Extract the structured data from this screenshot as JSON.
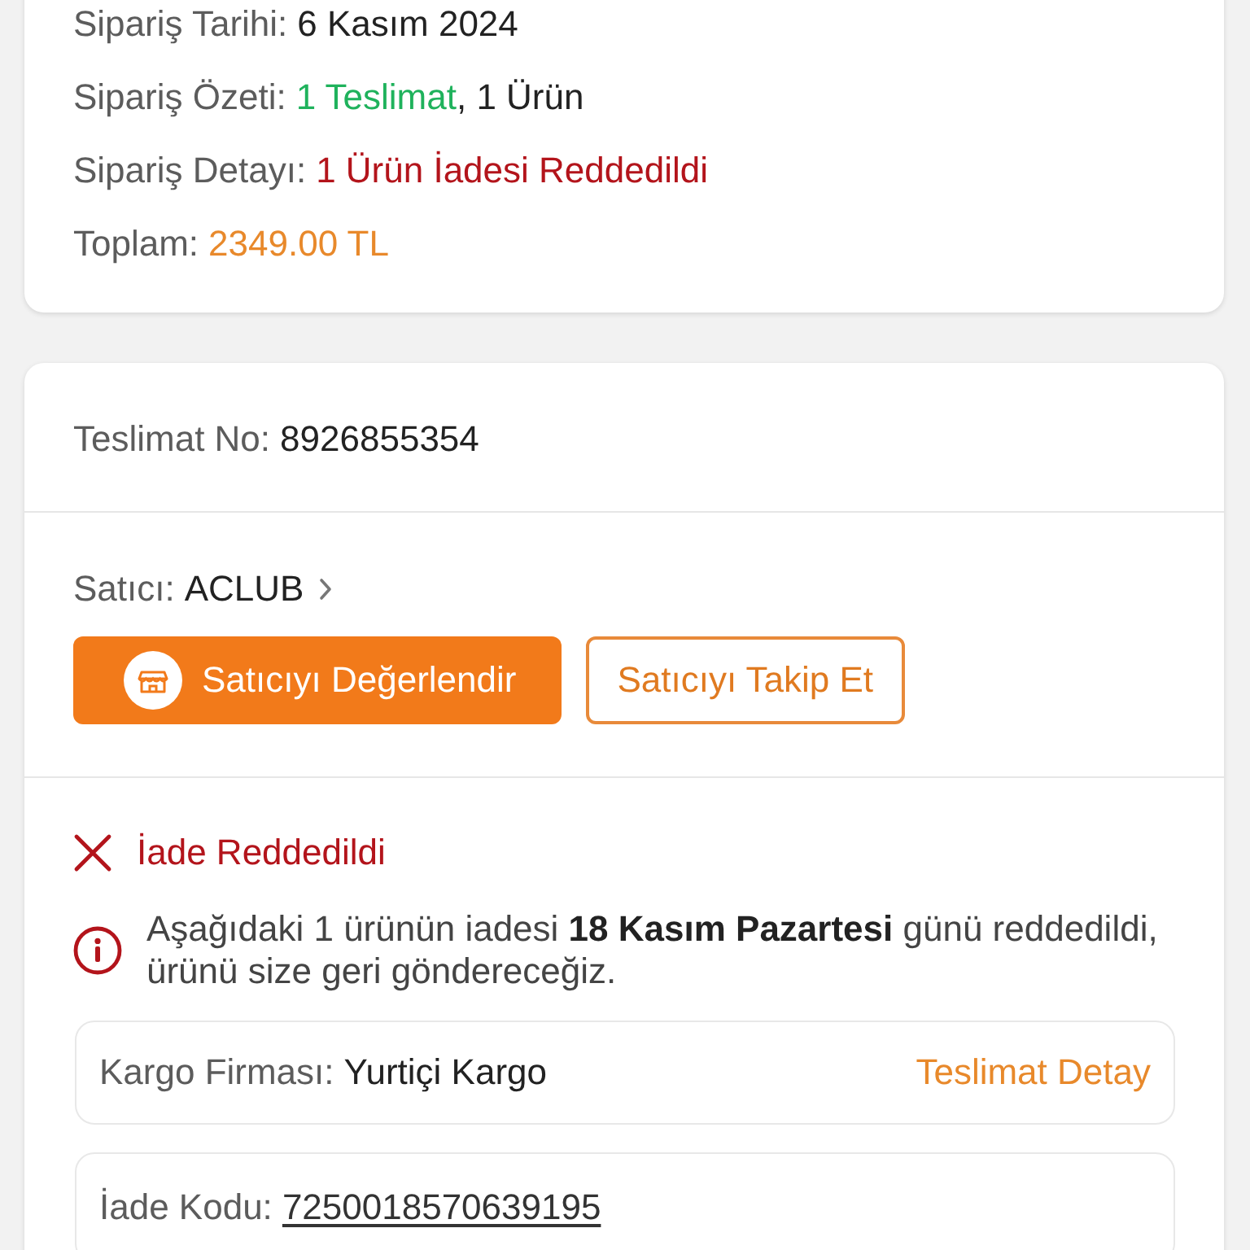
{
  "order_summary": {
    "rows": [
      {
        "label": "Sipariş Tarihi:",
        "value": [
          {
            "text": "6 Kasım 2024",
            "kind": "plain"
          }
        ]
      },
      {
        "label": "Sipariş Özeti:",
        "value": [
          {
            "text": "1 Teslimat",
            "kind": "success"
          },
          {
            "text": ", 1 Ürün",
            "kind": "plain"
          }
        ]
      },
      {
        "label": "Sipariş Detayı:",
        "value": [
          {
            "text": "1 Ürün İadesi Reddedildi",
            "kind": "danger"
          }
        ]
      },
      {
        "label": "Toplam:",
        "value": [
          {
            "text": "2349.00 TL",
            "kind": "price"
          }
        ]
      }
    ]
  },
  "delivery": {
    "number_label": "Teslimat No:",
    "number": "8926855354",
    "seller": {
      "label": "Satıcı:",
      "name": "ACLUB"
    },
    "buttons": [
      {
        "label": "Satıcıyı Değerlendir",
        "kind": "primary"
      },
      {
        "label": "Satıcıyı Takip Et",
        "kind": "outline"
      }
    ],
    "return_status": {
      "rejected": true,
      "title": "İade Reddedildi",
      "message": "Aşağıdaki 1 ürünün iadesi **18 Kasım Pazartesi** günü reddedildi, ürünü size geri göndereceğiz."
    },
    "carrier": {
      "label": "Kargo Firması:",
      "name": "Yurtiçi Kargo",
      "link": "Teslimat Detay"
    },
    "return_code": {
      "label": "İade Kodu:",
      "code": "7250018570639195"
    }
  }
}
